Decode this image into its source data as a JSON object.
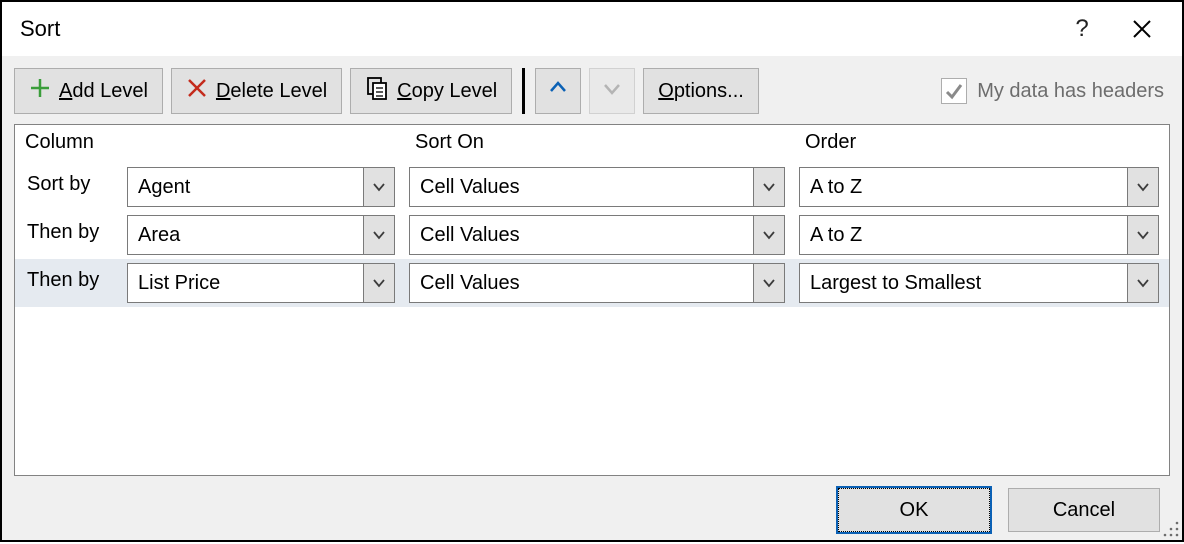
{
  "dialog": {
    "title": "Sort"
  },
  "toolbar": {
    "add_level": "Add Level",
    "delete_level": "Delete Level",
    "copy_level": "Copy Level",
    "options": "Options...",
    "headers_label": "My data has headers",
    "headers_checked": true,
    "headers_enabled": false,
    "move_up_enabled": true,
    "move_down_enabled": false
  },
  "headers": {
    "column": "Column",
    "sort_on": "Sort On",
    "order": "Order"
  },
  "levels": [
    {
      "label": "Sort by",
      "column": "Agent",
      "sort_on": "Cell Values",
      "order": "A to Z",
      "selected": false
    },
    {
      "label": "Then by",
      "column": "Area",
      "sort_on": "Cell Values",
      "order": "A to Z",
      "selected": false
    },
    {
      "label": "Then by",
      "column": "List Price",
      "sort_on": "Cell Values",
      "order": "Largest to Smallest",
      "selected": true
    }
  ],
  "footer": {
    "ok": "OK",
    "cancel": "Cancel"
  },
  "icons": {
    "help": "?",
    "close": "✕"
  }
}
